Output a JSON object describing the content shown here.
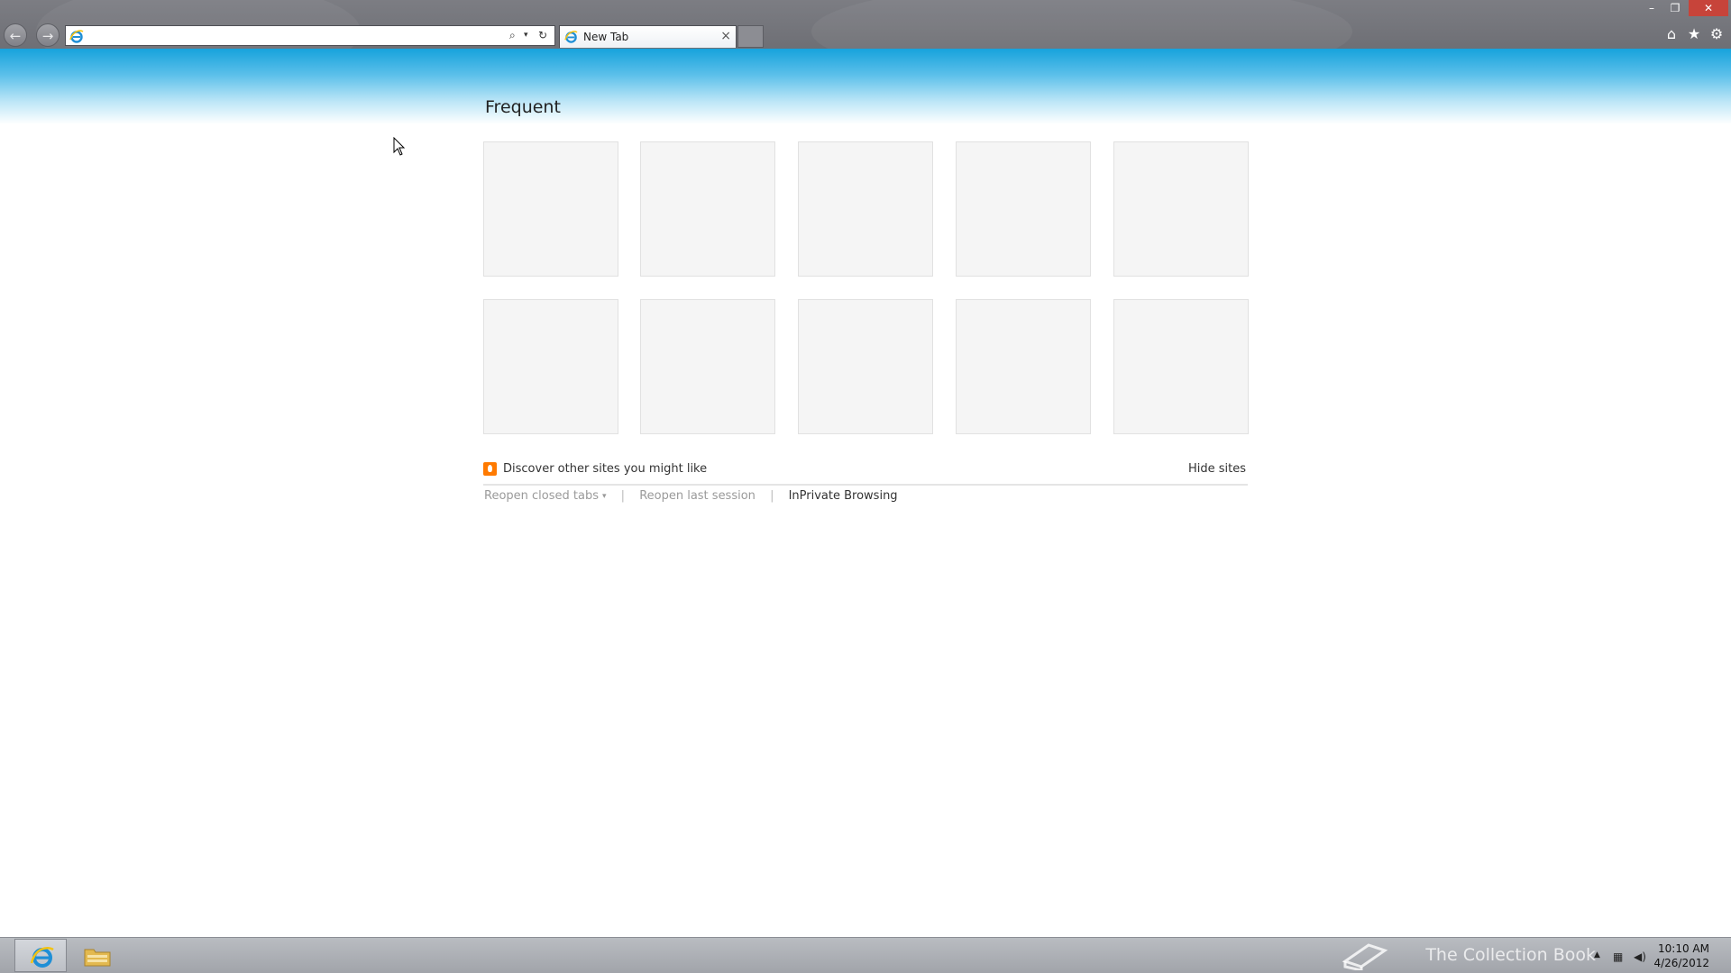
{
  "browser": {
    "address_value": "",
    "tab_title": "New Tab",
    "tab_close_glyph": "×",
    "back_glyph": "←",
    "forward_glyph": "→",
    "search_glyph": "⌕",
    "dropdown_glyph": "▾",
    "refresh_glyph": "↻",
    "minimize_glyph": "–",
    "restore_glyph": "❐",
    "close_glyph": "✕",
    "home_glyph": "⌂",
    "favorites_glyph": "★",
    "tools_glyph": "⚙"
  },
  "newtab": {
    "section_title": "Frequent",
    "tile_count": 10,
    "discover_text": "Discover other sites you might like",
    "hide_sites": "Hide sites",
    "reopen_closed_tabs": "Reopen closed tabs",
    "reopen_last_session": "Reopen last session",
    "inprivate": "InPrivate Browsing",
    "separator": "|"
  },
  "taskbar": {
    "time": "10:10 AM",
    "date": "4/26/2012",
    "watermark": "The Collection Book"
  },
  "colors": {
    "ie_blue": "#1f8fd6",
    "ie_gold": "#f3c314",
    "discover_orange": "#ff7a00",
    "page_gradient_top": "#17a2dc"
  }
}
